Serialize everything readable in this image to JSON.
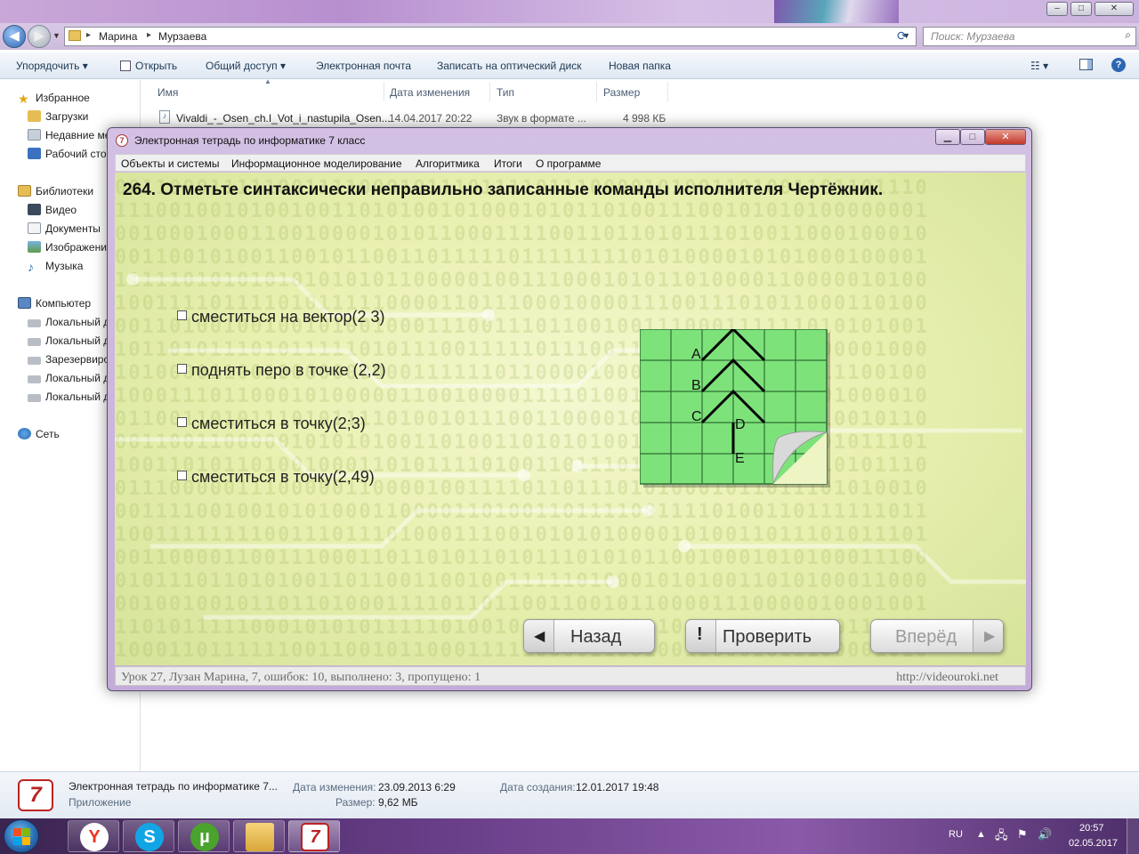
{
  "explorer": {
    "breadcrumb": [
      "Марина",
      "Мурзаева"
    ],
    "search_placeholder": "Поиск: Мурзаева",
    "commands": [
      "Упорядочить",
      "Открыть",
      "Общий доступ",
      "Электронная почта",
      "Записать на оптический диск",
      "Новая папка"
    ],
    "nav": {
      "favorites": "Избранное",
      "favorites_items": [
        "Загрузки",
        "Недавние ме",
        "Рабочий сто"
      ],
      "libraries": "Библиотеки",
      "libraries_items": [
        "Видео",
        "Документы",
        "Изображени",
        "Музыка"
      ],
      "computer": "Компьютер",
      "computer_items": [
        "Локальный д",
        "Локальный д",
        "Зарезервиро",
        "Локальный д",
        "Локальный д"
      ],
      "network": "Сеть"
    },
    "columns": [
      "Имя",
      "Дата изменения",
      "Тип",
      "Размер"
    ],
    "files": [
      {
        "name": "Vivaldi_-_Osen_ch.I_Vot_i_nastupila_Osen...",
        "date": "14.04.2017 20:22",
        "type": "Звук в формате ...",
        "size": "4 998 КБ"
      }
    ],
    "details": {
      "name": "Электронная тетрадь по информатике 7...",
      "kind": "Приложение",
      "modified_label": "Дата изменения:",
      "modified": "23.09.2013 6:29",
      "size_label": "Размер:",
      "size": "9,62 МБ",
      "created_label": "Дата создания:",
      "created": "12.01.2017 19:48"
    }
  },
  "app": {
    "title": "Электронная тетрадь по информатике 7 класс",
    "menu": [
      "Объекты и системы",
      "Информационное моделирование",
      "Алгоритмика",
      "Итоги",
      "О программе"
    ],
    "question": "264. Отметьте синтаксически неправильно записанные команды исполнителя Чертёжник.",
    "options": [
      "сместиться на вектор(2 3)",
      "поднять перо в точке (2,2)",
      "сместиться в точку(2;3)",
      "сместиться в точку(2,49)"
    ],
    "figure_labels": [
      "A",
      "B",
      "C",
      "D",
      "E"
    ],
    "buttons": {
      "back": "Назад",
      "check": "Проверить",
      "forward": "Вперёд"
    },
    "status_left": "Урок 27, Лузан Марина, 7, ошибок: 10, выполнено: 3, пропущено: 1",
    "status_right": "http://videouroki.net",
    "colors": {
      "grid_fill": "#7de27a",
      "grid_line": "#2f6f34",
      "content_bg": "#eef4c4"
    }
  },
  "taskbar": {
    "apps": [
      "yandex-browser-icon",
      "skype-icon",
      "utorrent-icon",
      "explorer-icon",
      "notebook-app-icon"
    ],
    "lang": "RU",
    "time": "20:57",
    "date": "02.05.2017"
  }
}
